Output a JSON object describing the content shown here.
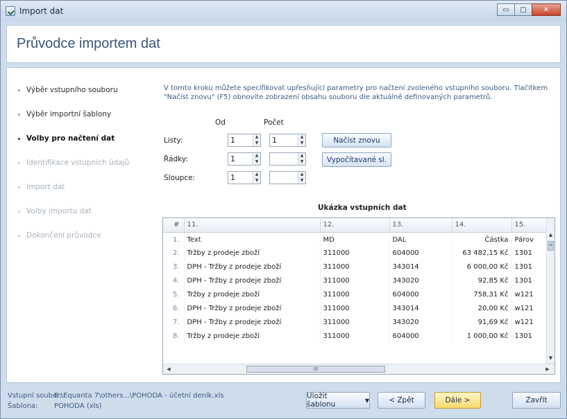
{
  "window": {
    "title": "Import dat",
    "controls": {
      "minimize": "▭",
      "maximize": "□",
      "close": "✕"
    }
  },
  "header": {
    "title": "Průvodce importem dat"
  },
  "steps": [
    {
      "label": "Výběr vstupního souboru",
      "state": "done"
    },
    {
      "label": "Výběr importní šablony",
      "state": "done"
    },
    {
      "label": "Volby pro načtení dat",
      "state": "active"
    },
    {
      "label": "Identifikace vstupních údajů",
      "state": "disabled"
    },
    {
      "label": "Import dat",
      "state": "disabled"
    },
    {
      "label": "Volby importu dat",
      "state": "disabled"
    },
    {
      "label": "Dokončení průvodce",
      "state": "disabled"
    }
  ],
  "description": "V tomto kroku můžete specifikovat upřesňující parametry pro načtení zvoleného vstupního souboru. Tlačítkem \"Načíst znovu\" (F5) obnovíte zobrazení obsahu souboru dle aktuálně definovaných parametrů.",
  "params": {
    "col_from": "Od",
    "col_count": "Počet",
    "rows": [
      {
        "label": "Listy:",
        "from": "1",
        "count": "1"
      },
      {
        "label": "Řádky:",
        "from": "1",
        "count": ""
      },
      {
        "label": "Sloupce:",
        "from": "1",
        "count": ""
      }
    ]
  },
  "buttons": {
    "reload": "Načíst znovu",
    "computed": "Vypočítavané sl."
  },
  "grid": {
    "title": "Ukázka vstupních dat",
    "columns": [
      "#",
      "11.",
      "12.",
      "13.",
      "14.",
      "15."
    ],
    "rows": [
      [
        "1.",
        "Text",
        "MD",
        "DAL",
        "Částka",
        "Párov"
      ],
      [
        "2.",
        "Tržby z prodeje zboží",
        "311000",
        "604000",
        "63 482,15 Kč",
        "1301"
      ],
      [
        "3.",
        "DPH - Tržby z prodeje zboží",
        "311000",
        "343014",
        "6 000,00 Kč",
        "1301"
      ],
      [
        "4.",
        "DPH - Tržby z prodeje zboží",
        "311000",
        "343020",
        "92,85 Kč",
        "1301"
      ],
      [
        "5.",
        "Tržby z prodeje zboží",
        "311000",
        "604000",
        "758,31 Kč",
        "w121"
      ],
      [
        "6.",
        "DPH - Tržby z prodeje zboží",
        "311000",
        "343014",
        "20,00 Kč",
        "w121"
      ],
      [
        "7.",
        "DPH - Tržby z prodeje zboží",
        "311000",
        "343020",
        "91,69 Kč",
        "w121"
      ],
      [
        "8.",
        "Tržby z prodeje zboží",
        "311000",
        "604000",
        "1 000,00 Kč",
        "1301"
      ]
    ]
  },
  "footer": {
    "input_label": "Vstupní soubor:",
    "input_value": "E:\\Equanta 7\\others...\\POHODA - účetní deník.xls",
    "template_label": "Šablona:",
    "template_value": "POHODA (xls)",
    "save_template": "Uložit šablonu",
    "back": "< Zpět",
    "next": "Dále >",
    "close": "Zavřít"
  }
}
